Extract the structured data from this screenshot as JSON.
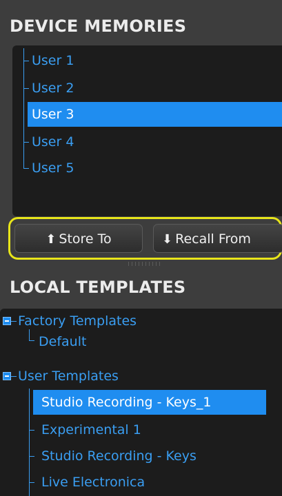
{
  "device_memories": {
    "title": "DEVICE MEMORIES",
    "items": [
      {
        "label": "User 1",
        "selected": false
      },
      {
        "label": "User 2",
        "selected": false
      },
      {
        "label": "User 3",
        "selected": true
      },
      {
        "label": "User 4",
        "selected": false
      },
      {
        "label": "User 5",
        "selected": false
      }
    ]
  },
  "buttons": {
    "store_label": "Store To",
    "recall_label": "Recall From",
    "store_icon": "arrow-up-icon",
    "recall_icon": "arrow-down-icon",
    "highlight_color": "#e8e51a"
  },
  "local_templates": {
    "title": "LOCAL TEMPLATES",
    "groups": [
      {
        "label": "Factory Templates",
        "expanded": true,
        "items": [
          {
            "label": "Default",
            "selected": false
          }
        ]
      },
      {
        "label": "User Templates",
        "expanded": true,
        "items": [
          {
            "label": "Studio Recording - Keys_1",
            "selected": true
          },
          {
            "label": "Experimental 1",
            "selected": false
          },
          {
            "label": "Studio Recording - Keys",
            "selected": false
          },
          {
            "label": "Live Electronica",
            "selected": false
          }
        ]
      }
    ]
  },
  "colors": {
    "accent": "#1f8df0",
    "tree_text": "#3a9ef2",
    "background": "#3d3d3d",
    "panel": "#1c1c1c"
  }
}
